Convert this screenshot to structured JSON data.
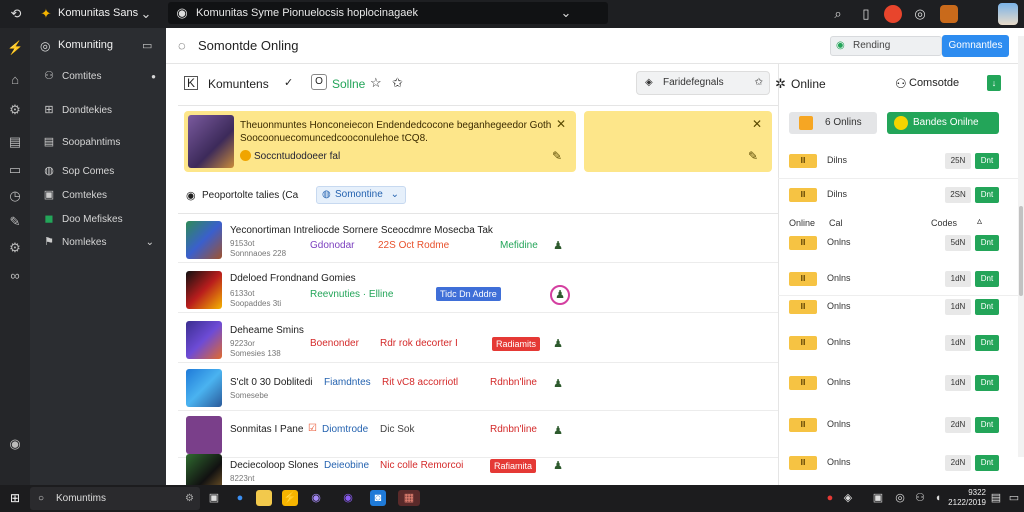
{
  "topbar": {
    "app_name": "Komunitas Sans",
    "address": "Komunitas Syme Pionuelocsis hoplocinagaek",
    "icons": [
      "back-icon",
      "logo-icon",
      "chevron-down-icon",
      "search-icon",
      "bookmark-icon",
      "record-icon",
      "globe-icon",
      "extension-icon",
      "avatar-icon"
    ]
  },
  "sidebar": {
    "title": "Komuniting",
    "items": [
      {
        "label": "Comtites",
        "icon": "users-icon"
      },
      {
        "label": "Dondtekies",
        "icon": "grid-icon"
      },
      {
        "label": "Soopahntims",
        "icon": "layers-icon"
      },
      {
        "label": "Sop Comes",
        "icon": "game-icon"
      },
      {
        "label": "Comtekes",
        "icon": "chat-icon"
      },
      {
        "label": "Doo Mefiskes",
        "icon": "leaf-icon"
      },
      {
        "label": "Nomlekes",
        "icon": "tag-icon"
      }
    ]
  },
  "main": {
    "title": "Somontde Onling",
    "search_label": "Rending",
    "blue_button": "Gomnantles",
    "tabs": [
      {
        "label": "Komuntens"
      },
      {
        "label": "Sollne"
      }
    ],
    "tab_chip": "Faridefegnals",
    "online_header": "Online",
    "community_header": "Comsotde",
    "online_count_label": "6 Onlins",
    "green_button": "Bandes Onilne",
    "banner": {
      "line1": "Theuonmuntes Honconeiecon Endendedcocone beganhegeedor Goth",
      "line2": "Soocoonuecomuncedcooconulehoe tCQ8.",
      "link": "Soccntudodoeer fal"
    },
    "filter": {
      "label": "Peoportolte talies (Ca",
      "select": "Somontine"
    },
    "col_headers": {
      "online": "Online",
      "cal": "Cal",
      "codes": "Codes"
    },
    "rows": [
      {
        "title": "Yeconortiman Intreliocde Sornere Sceocdmre Mosecba Tak",
        "sub1": "9153ot",
        "sub2": "Sonnnaoes 228",
        "tag1": "Gdonodar",
        "tag2": "22S Oct Rodme",
        "tag3": "Mefidine",
        "badge": ""
      },
      {
        "title": "Ddeloed Frondnand Gomies",
        "sub1": "6133ot",
        "sub2": "Soopaddes 3ti",
        "tag1": "Reevnuties · Elline",
        "tag2": "",
        "tag3": "",
        "badge": "Tidc Dn Addre"
      },
      {
        "title": "Deheame Smins",
        "sub1": "9223or",
        "sub2": "Somesies 138",
        "tag1": "Boenonder",
        "tag2": "Rdr rok decorter I",
        "tag3": "",
        "badge": "Radiamits"
      },
      {
        "title": "S'clt 0 30 Doblitedi",
        "sub1": "Somesebe",
        "sub2": "",
        "tag1": "Fiamdntes",
        "tag2": "Rit vC8 accorriotl",
        "tag3": "Rdnbn'line",
        "badge": ""
      },
      {
        "title": "Sonmitas I Pane",
        "sub1": "",
        "sub2": "",
        "tag1": "Diomtrode",
        "tag2": "Dic Sok",
        "tag3": "Rdnbn'line",
        "badge": ""
      },
      {
        "title": "Deciecoloop Slones",
        "sub1": "8223nt",
        "sub2": "",
        "tag1": "Deieobine",
        "tag2": "Nic colle Remorcoi",
        "tag3": "",
        "badge": "Rafiamita"
      }
    ],
    "right_rows": [
      {
        "label": "Dilns",
        "gray": "25N",
        "green": "Dnt"
      },
      {
        "label": "Dilns",
        "gray": "2SN",
        "green": "Dnt"
      },
      {
        "label": "Onlns",
        "gray": "5dN",
        "green": "Dnt"
      },
      {
        "label": "Onlns",
        "gray": "1dN",
        "green": "Dnt"
      },
      {
        "label": "Onlns",
        "gray": "1dN",
        "green": "Dnt"
      },
      {
        "label": "Onlns",
        "gray": "1dN",
        "green": "Dnt"
      },
      {
        "label": "Onlns",
        "gray": "1dN",
        "green": "Dnt"
      },
      {
        "label": "Onlns",
        "gray": "2dN",
        "green": "Dnt"
      },
      {
        "label": "Onlns",
        "gray": "2dN",
        "green": "Dnt"
      },
      {
        "label": "Onlns",
        "gray": "2dN",
        "green": "Dnt"
      }
    ]
  },
  "taskbar": {
    "search": "Komuntims",
    "time": "9322",
    "date": "2122/2019"
  }
}
